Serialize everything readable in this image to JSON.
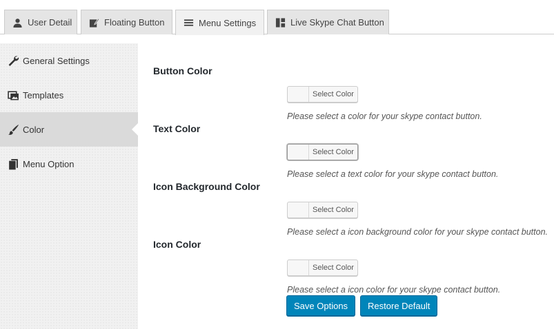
{
  "tabs": [
    {
      "label": "User Detail",
      "icon": "user-icon"
    },
    {
      "label": "Floating Button",
      "icon": "edit-icon"
    },
    {
      "label": "Menu Settings",
      "icon": "menu-icon",
      "active": true
    },
    {
      "label": "Live Skype Chat Button",
      "icon": "layout-icon"
    }
  ],
  "sidebar": {
    "items": [
      {
        "label": "General Settings",
        "icon": "wrench-icon"
      },
      {
        "label": "Templates",
        "icon": "images-icon"
      },
      {
        "label": "Color",
        "icon": "brush-icon",
        "active": true
      },
      {
        "label": "Menu Option",
        "icon": "pages-icon"
      }
    ]
  },
  "settings": [
    {
      "label": "Button Color",
      "button": "Select Color",
      "description": "Please select a color for your skype contact button."
    },
    {
      "label": "Text Color",
      "button": "Select Color",
      "description": "Please select a text color for your skype contact button."
    },
    {
      "label": "Icon Background Color",
      "button": "Select Color",
      "description": "Please select a icon background color for your skype contact button."
    },
    {
      "label": "Icon Color",
      "button": "Select Color",
      "description": "Please select a icon color for your skype contact button."
    }
  ],
  "actions": {
    "save_label": "Save Options",
    "restore_label": "Restore Default"
  },
  "colors": {
    "primary": "#0085ba",
    "tab_bg": "#e5e5e5",
    "sidebar_bg": "#f1f1f1",
    "sidebar_active": "#dadada"
  }
}
